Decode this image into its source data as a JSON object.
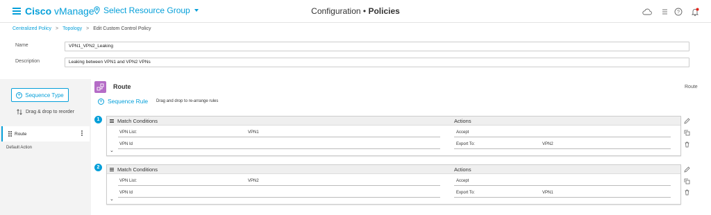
{
  "header": {
    "brand_bold": "Cisco",
    "brand_light": "vManage",
    "resource_group": "Select Resource Group",
    "title_prefix": "Configuration",
    "title_sep": "•",
    "title_main": "Policies",
    "icons": [
      "cloud-icon",
      "list-icon",
      "help-icon",
      "bell-icon"
    ],
    "accent_color": "#049fd9",
    "alert_color": "#e2231a"
  },
  "breadcrumb": {
    "items": [
      "Centralized Policy",
      "Topology"
    ],
    "current": "Edit Custom Control Policy",
    "separator": ">"
  },
  "form": {
    "name_label": "Name",
    "name_value": "VPN1_VPN2_Leaking",
    "description_label": "Description",
    "description_value": "Leaking between VPN1 and VPN2 VPNs"
  },
  "left_panel": {
    "sequence_type_label": "Sequence Type",
    "drag_reorder_label": "Drag & drop to reorder",
    "sequences": [
      {
        "label": "Route",
        "selected": true
      }
    ],
    "default_action_label": "Default Action"
  },
  "main": {
    "route_title": "Route",
    "route_right_label": "Route",
    "route_icon_color": "#b56cc7",
    "sequence_rule_label": "Sequence Rule",
    "sequence_rule_hint": "Drag and drop to re-arrange rules",
    "rules": [
      {
        "number": "1",
        "match_header": "Match Conditions",
        "actions_header": "Actions",
        "conditions": [
          {
            "key": "VPN List:",
            "value": "VPN1"
          },
          {
            "key": "VPN Id",
            "value": ""
          }
        ],
        "actions": [
          {
            "key": "Accept",
            "value": ""
          },
          {
            "key": "Export To:",
            "value": "VPN2"
          }
        ]
      },
      {
        "number": "2",
        "match_header": "Match Conditions",
        "actions_header": "Actions",
        "conditions": [
          {
            "key": "VPN List:",
            "value": "VPN2"
          },
          {
            "key": "VPN Id",
            "value": ""
          }
        ],
        "actions": [
          {
            "key": "Accept",
            "value": ""
          },
          {
            "key": "Export To:",
            "value": "VPN1"
          }
        ]
      }
    ]
  }
}
